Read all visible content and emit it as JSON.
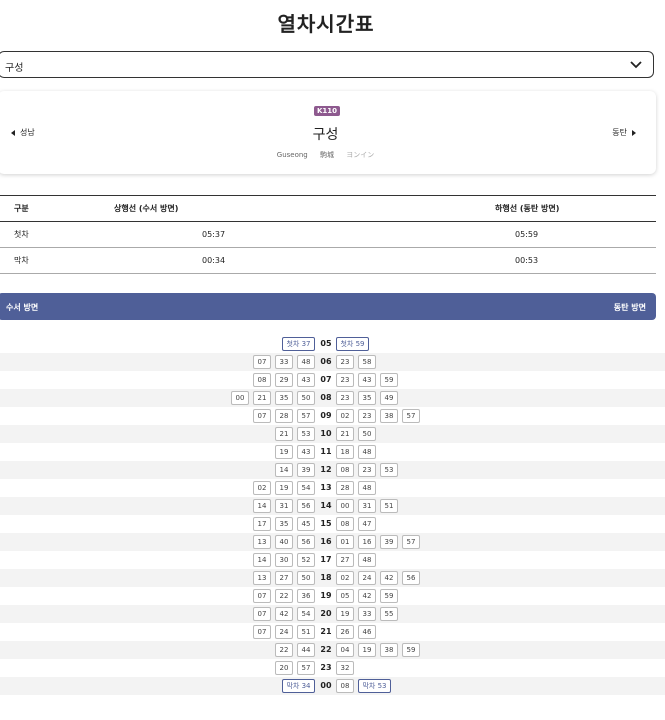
{
  "page": {
    "title": "열차시간표"
  },
  "station_select": {
    "value": "구성"
  },
  "station": {
    "line_badge": "K110",
    "name": "구성",
    "name_en": "Guseong",
    "name_zh": "駒城",
    "name_ja": "ヨンイン",
    "prev": "성남",
    "next": "동탄"
  },
  "firstlast": {
    "headers": [
      "구분",
      "상행선 (수서 방면)",
      "하행선 (동탄 방면)"
    ],
    "rows": [
      {
        "label": "첫차",
        "up": "05:37",
        "down": "05:59"
      },
      {
        "label": "막차",
        "up": "00:34",
        "down": "00:53"
      }
    ]
  },
  "direction_bar": {
    "left": "수서 방면",
    "right": "동탄 방면"
  },
  "timetable": [
    {
      "hour": "05",
      "up": [
        "첫차 37"
      ],
      "down": [
        "첫차 59"
      ]
    },
    {
      "hour": "06",
      "up": [
        "07",
        "33",
        "48"
      ],
      "down": [
        "23",
        "58"
      ]
    },
    {
      "hour": "07",
      "up": [
        "08",
        "29",
        "43"
      ],
      "down": [
        "23",
        "43",
        "59"
      ]
    },
    {
      "hour": "08",
      "up": [
        "00",
        "21",
        "35",
        "50"
      ],
      "down": [
        "23",
        "35",
        "49"
      ]
    },
    {
      "hour": "09",
      "up": [
        "07",
        "28",
        "57"
      ],
      "down": [
        "02",
        "23",
        "38",
        "57"
      ]
    },
    {
      "hour": "10",
      "up": [
        "21",
        "53"
      ],
      "down": [
        "21",
        "50"
      ]
    },
    {
      "hour": "11",
      "up": [
        "19",
        "43"
      ],
      "down": [
        "18",
        "48"
      ]
    },
    {
      "hour": "12",
      "up": [
        "14",
        "39"
      ],
      "down": [
        "08",
        "23",
        "53"
      ]
    },
    {
      "hour": "13",
      "up": [
        "02",
        "19",
        "54"
      ],
      "down": [
        "28",
        "48"
      ]
    },
    {
      "hour": "14",
      "up": [
        "14",
        "31",
        "56"
      ],
      "down": [
        "00",
        "31",
        "51"
      ]
    },
    {
      "hour": "15",
      "up": [
        "17",
        "35",
        "45"
      ],
      "down": [
        "08",
        "47"
      ]
    },
    {
      "hour": "16",
      "up": [
        "13",
        "40",
        "56"
      ],
      "down": [
        "01",
        "16",
        "39",
        "57"
      ]
    },
    {
      "hour": "17",
      "up": [
        "14",
        "30",
        "52"
      ],
      "down": [
        "27",
        "48"
      ]
    },
    {
      "hour": "18",
      "up": [
        "13",
        "27",
        "50"
      ],
      "down": [
        "02",
        "24",
        "42",
        "56"
      ]
    },
    {
      "hour": "19",
      "up": [
        "07",
        "22",
        "36"
      ],
      "down": [
        "05",
        "42",
        "59"
      ]
    },
    {
      "hour": "20",
      "up": [
        "07",
        "42",
        "54"
      ],
      "down": [
        "19",
        "33",
        "55"
      ]
    },
    {
      "hour": "21",
      "up": [
        "07",
        "24",
        "51"
      ],
      "down": [
        "26",
        "46"
      ]
    },
    {
      "hour": "22",
      "up": [
        "22",
        "44"
      ],
      "down": [
        "04",
        "19",
        "38",
        "59"
      ]
    },
    {
      "hour": "23",
      "up": [
        "20",
        "57"
      ],
      "down": [
        "32"
      ]
    },
    {
      "hour": "00",
      "up": [
        "막차 34"
      ],
      "down": [
        "08",
        "막차 53"
      ]
    }
  ],
  "icons": {
    "select_chevron": "chevron-down-icon",
    "prev": "triangle-left-icon",
    "next": "triangle-right-icon"
  }
}
